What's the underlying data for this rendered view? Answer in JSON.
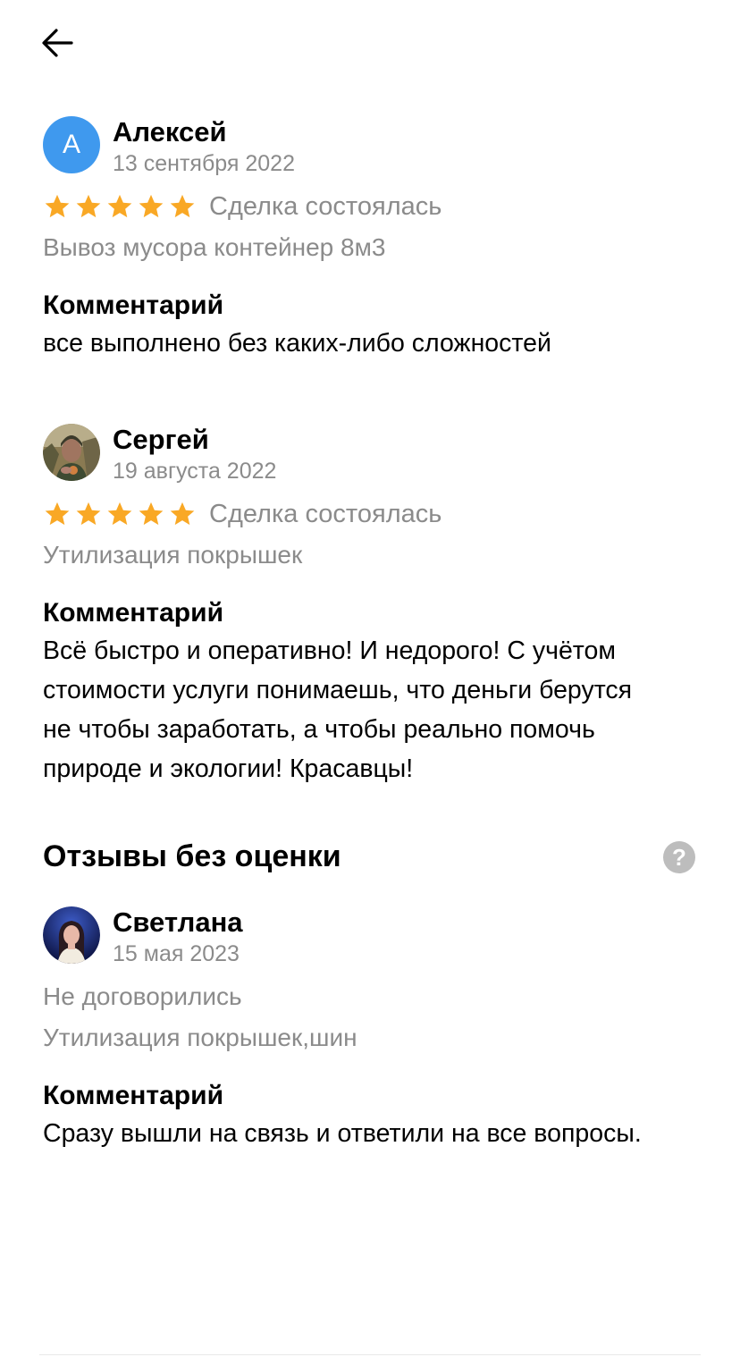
{
  "header": {
    "back_icon": "arrow-left-icon"
  },
  "reviews": [
    {
      "avatar_letter": "А",
      "avatar_color": "#3f99ee",
      "name": "Алексей",
      "date": "13 сентября 2022",
      "rating": 5,
      "deal_status": "Сделка состоялась",
      "service": "Вывоз мусора контейнер 8м3",
      "comment_title": "Комментарий",
      "comment": "все выполнено без каких-либо сложностей"
    },
    {
      "name": "Сергей",
      "date": "19 августа 2022",
      "rating": 5,
      "deal_status": "Сделка состоялась",
      "service": "Утилизация покрышек",
      "comment_title": "Комментарий",
      "comment_lines": [
        "Всё быстро и оперативно! И недорого! С учётом",
        "стоимости услуги понимаешь, что деньги берутся",
        "не чтобы заработать, а чтобы реально помочь",
        "природе и экологии! Красавцы!"
      ]
    }
  ],
  "unrated_section": {
    "title": "Отзывы без оценки",
    "help_icon": "question-circle-icon",
    "help_glyph": "?",
    "reviews": [
      {
        "name": "Светлана",
        "date": "15 мая 2023",
        "status": "Не договорились",
        "service": "Утилизация покрышек,шин",
        "comment_title": "Комментарий",
        "comment": "Сразу вышли на связь и ответили на все вопросы."
      }
    ]
  },
  "colors": {
    "star": "#f9a825",
    "secondary_text": "#8b8b8b",
    "accent": "#3f99ee"
  }
}
